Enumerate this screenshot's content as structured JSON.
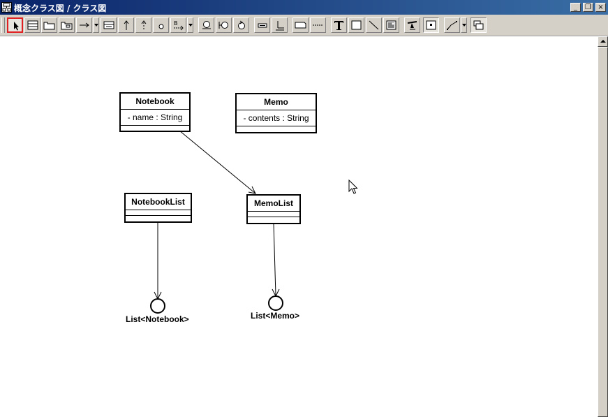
{
  "window": {
    "title": "概念クラス図 / クラス図",
    "minimize": "_",
    "restore": "❐",
    "close": "×"
  },
  "toolbar": {
    "tools": [
      "select-tool",
      "class-tool",
      "package-tool",
      "subsystem-tool",
      "association-tool",
      "dropdown",
      "attribute-tool",
      "generalization-tool",
      "realization-tool",
      "interface-tool",
      "dependency-tool",
      "dropdown",
      "boundary-tool",
      "control-tool",
      "entity-tool",
      "note-tool",
      "note-anchor-tool",
      "partition-tool",
      "dashed-line-tool",
      "text-tool",
      "rect-tool",
      "line-tool",
      "image-tool",
      "stamp-tool",
      "center-tool",
      "connector-tool",
      "dropdown",
      "overlay-tool"
    ]
  },
  "diagram": {
    "classes": [
      {
        "name": "Notebook",
        "attributes": [
          "- name : String"
        ]
      },
      {
        "name": "Memo",
        "attributes": [
          "- contents : String"
        ]
      },
      {
        "name": "NotebookList",
        "attributes": []
      },
      {
        "name": "MemoList",
        "attributes": []
      }
    ],
    "interfaces": [
      {
        "name": "List<Notebook>"
      },
      {
        "name": "List<Memo>"
      }
    ]
  }
}
